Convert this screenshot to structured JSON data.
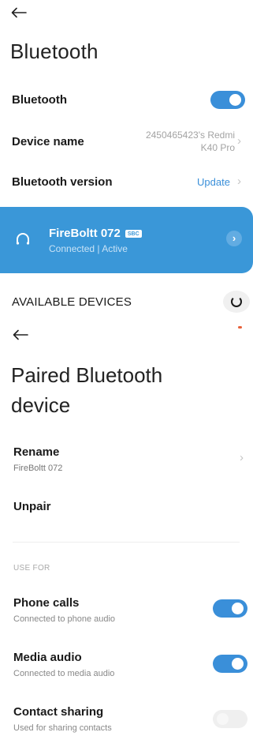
{
  "top": {
    "title": "Bluetooth",
    "rows": {
      "bluetooth": {
        "label": "Bluetooth",
        "enabled": true
      },
      "device_name": {
        "label": "Device name",
        "value_line1": "2450465423's Redmi",
        "value_line2": "K40 Pro"
      },
      "bt_version": {
        "label": "Bluetooth version",
        "value": "Update"
      }
    },
    "connected_device": {
      "name": "FireBoltt 072",
      "codec": "SBC",
      "status": "Connected",
      "separator": "|",
      "state": "Active"
    },
    "available": {
      "label": "AVAILABLE DEVICES"
    }
  },
  "detail": {
    "title": "Paired Bluetooth device",
    "rename": {
      "label": "Rename",
      "value": "FireBoltt 072"
    },
    "unpair": {
      "label": "Unpair"
    },
    "section": "USE FOR",
    "options": [
      {
        "label": "Phone calls",
        "sub": "Connected to phone audio",
        "enabled": true
      },
      {
        "label": "Media audio",
        "sub": "Connected to media audio",
        "enabled": true
      },
      {
        "label": "Contact sharing",
        "sub": "Used for sharing contacts",
        "enabled": false
      }
    ]
  },
  "colors": {
    "accent": "#3a8fd9",
    "card": "#3a97d8",
    "update_link": "#3a8fd9"
  }
}
